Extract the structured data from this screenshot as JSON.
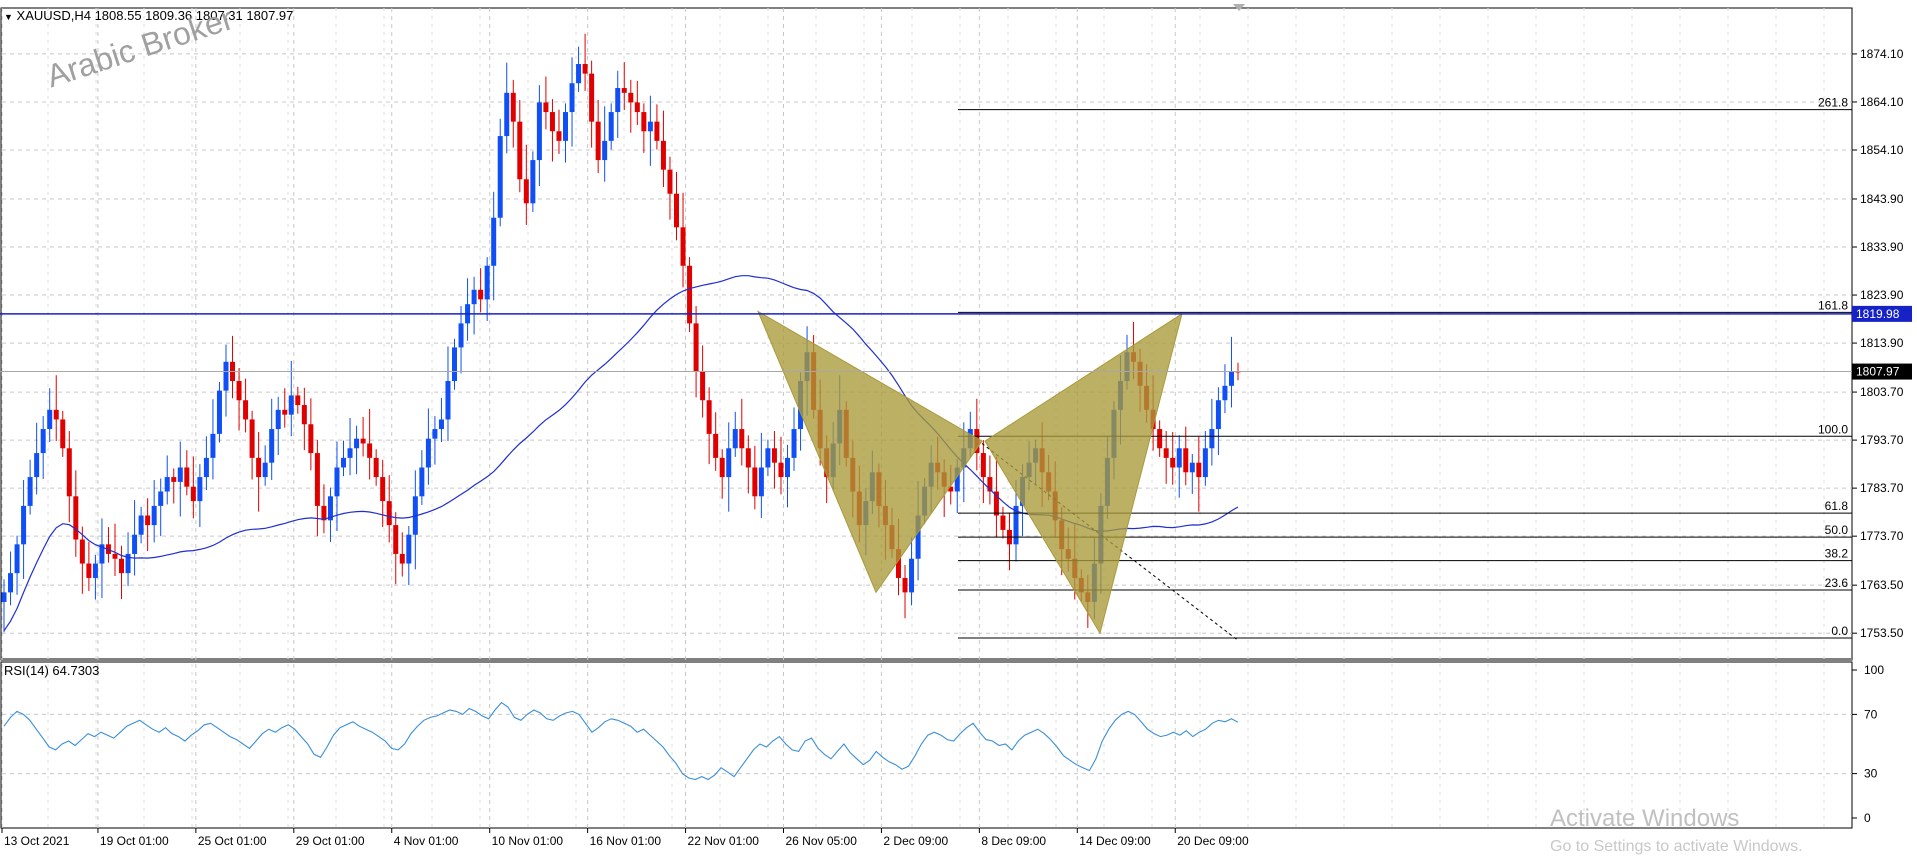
{
  "header": {
    "symbol_info": "XAUUSD,H4  1808.55 1809.36 1807.31 1807.97",
    "watermark": "Arabic Broker"
  },
  "rsi": {
    "label": "RSI(14) 64.7303",
    "levels": [
      "100",
      "70",
      "30",
      "0"
    ]
  },
  "activation": {
    "title": "Activate Windows",
    "subtitle": "Go to Settings to activate Windows."
  },
  "colors": {
    "bull": "#0f4ff5",
    "bear": "#e00000",
    "ma": "#1f2fcf",
    "rsi": "#3a8fd8",
    "pattern": "#a99a3a",
    "level_line": "#1722c6",
    "grid": "#c8c8c8"
  },
  "chart_data": [
    {
      "type": "candlestick",
      "title": "XAUUSD,H4",
      "ohlc_last": {
        "open": 1808.55,
        "high": 1809.36,
        "low": 1807.31,
        "close": 1807.97
      },
      "y_ticks": [
        "1874.10",
        "1864.10",
        "1854.10",
        "1843.90",
        "1833.90",
        "1823.90",
        "1813.90",
        "1803.70",
        "1793.70",
        "1783.70",
        "1773.70",
        "1763.50",
        "1753.50"
      ],
      "ylim": [
        1750,
        1877
      ],
      "x_ticks": [
        "13 Oct 2021",
        "19 Oct 01:00",
        "25 Oct 01:00",
        "29 Oct 01:00",
        "4 Nov 01:00",
        "10 Nov 01:00",
        "16 Nov 01:00",
        "22 Nov 01:00",
        "26 Nov 05:00",
        "2 Dec 09:00",
        "8 Dec 09:00",
        "14 Dec 09:00",
        "20 Dec 09:00"
      ],
      "current_price": "1807.97",
      "horizontal_level": {
        "label": "1819.98",
        "value": 1819.98
      },
      "fibonacci": [
        {
          "label": "261.8",
          "value": 1862.5
        },
        {
          "label": "161.8",
          "value": 1820.3
        },
        {
          "label": "100.0",
          "value": 1794.5
        },
        {
          "label": "61.8",
          "value": 1778.5
        },
        {
          "label": "50.0",
          "value": 1773.5
        },
        {
          "label": "38.2",
          "value": 1768.6
        },
        {
          "label": "23.6",
          "value": 1762.5
        },
        {
          "label": "0.0",
          "value": 1752.5
        }
      ],
      "closes": [
        1762,
        1766,
        1772,
        1780,
        1786,
        1791,
        1796,
        1800,
        1798,
        1792,
        1782,
        1773,
        1768,
        1765,
        1768,
        1772,
        1770,
        1769,
        1766,
        1770,
        1774,
        1778,
        1776,
        1780,
        1783,
        1786,
        1785,
        1788,
        1784,
        1781,
        1786,
        1790,
        1795,
        1804,
        1810,
        1806,
        1802,
        1798,
        1790,
        1786,
        1789,
        1796,
        1800,
        1799,
        1803,
        1801,
        1797,
        1791,
        1780,
        1777,
        1782,
        1788,
        1790,
        1792,
        1794,
        1793,
        1790,
        1786,
        1781,
        1776,
        1770,
        1768,
        1774,
        1782,
        1788,
        1794,
        1796,
        1798,
        1806,
        1813,
        1818,
        1822,
        1825,
        1823,
        1830,
        1840,
        1857,
        1866,
        1860,
        1848,
        1843,
        1852,
        1864,
        1862,
        1858,
        1856,
        1862,
        1868,
        1872,
        1870,
        1860,
        1852,
        1856,
        1862,
        1867,
        1866,
        1864,
        1862,
        1858,
        1860,
        1856,
        1850,
        1845,
        1838,
        1830,
        1818,
        1808,
        1802,
        1795,
        1790,
        1786,
        1792,
        1796,
        1792,
        1788,
        1782,
        1788,
        1792,
        1789,
        1786,
        1790,
        1796,
        1806,
        1812,
        1800,
        1792,
        1786,
        1793,
        1800,
        1790,
        1783,
        1776,
        1781,
        1787,
        1780,
        1776,
        1771,
        1765,
        1762,
        1769,
        1778,
        1784,
        1789,
        1787,
        1784,
        1783,
        1788,
        1792,
        1796,
        1791,
        1786,
        1783,
        1778,
        1775,
        1772,
        1780,
        1786,
        1789,
        1792,
        1787,
        1783,
        1777,
        1771,
        1769,
        1765,
        1762,
        1760,
        1768,
        1780,
        1790,
        1800,
        1806,
        1812,
        1810,
        1805,
        1800,
        1796,
        1792,
        1790,
        1788,
        1792,
        1787,
        1789,
        1786,
        1792,
        1796,
        1802,
        1805,
        1808,
        1807.97
      ],
      "ma_period": 50
    },
    {
      "type": "line",
      "title": "RSI(14) 64.7303",
      "ylim": [
        0,
        100
      ],
      "y_ticks": [
        "100",
        "70",
        "30",
        "0"
      ],
      "values": [
        62,
        68,
        72,
        70,
        66,
        60,
        54,
        48,
        46,
        50,
        52,
        49,
        53,
        57,
        55,
        58,
        56,
        54,
        58,
        62,
        64,
        66,
        63,
        60,
        58,
        61,
        57,
        55,
        52,
        56,
        59,
        63,
        64,
        61,
        58,
        55,
        53,
        50,
        47,
        52,
        57,
        60,
        58,
        61,
        63,
        60,
        55,
        50,
        43,
        41,
        48,
        56,
        61,
        63,
        65,
        62,
        60,
        58,
        55,
        52,
        47,
        46,
        50,
        57,
        62,
        66,
        68,
        69,
        71,
        73,
        72,
        70,
        74,
        72,
        69,
        67,
        73,
        78,
        75,
        68,
        66,
        70,
        73,
        71,
        67,
        66,
        69,
        71,
        72,
        70,
        64,
        58,
        61,
        65,
        67,
        66,
        64,
        62,
        58,
        60,
        56,
        52,
        48,
        42,
        37,
        30,
        27,
        26,
        28,
        26,
        29,
        34,
        31,
        28,
        34,
        40,
        46,
        50,
        48,
        52,
        55,
        50,
        46,
        45,
        52,
        54,
        47,
        43,
        40,
        45,
        50,
        44,
        40,
        36,
        39,
        45,
        41,
        38,
        36,
        33,
        35,
        42,
        50,
        56,
        58,
        56,
        53,
        52,
        57,
        61,
        64,
        58,
        53,
        52,
        49,
        50,
        46,
        52,
        56,
        58,
        60,
        57,
        53,
        48,
        42,
        39,
        36,
        34,
        32,
        40,
        52,
        60,
        66,
        70,
        72,
        70,
        65,
        60,
        57,
        55,
        56,
        58,
        56,
        59,
        55,
        58,
        60,
        64,
        66,
        65,
        67,
        64.73
      ]
    }
  ]
}
